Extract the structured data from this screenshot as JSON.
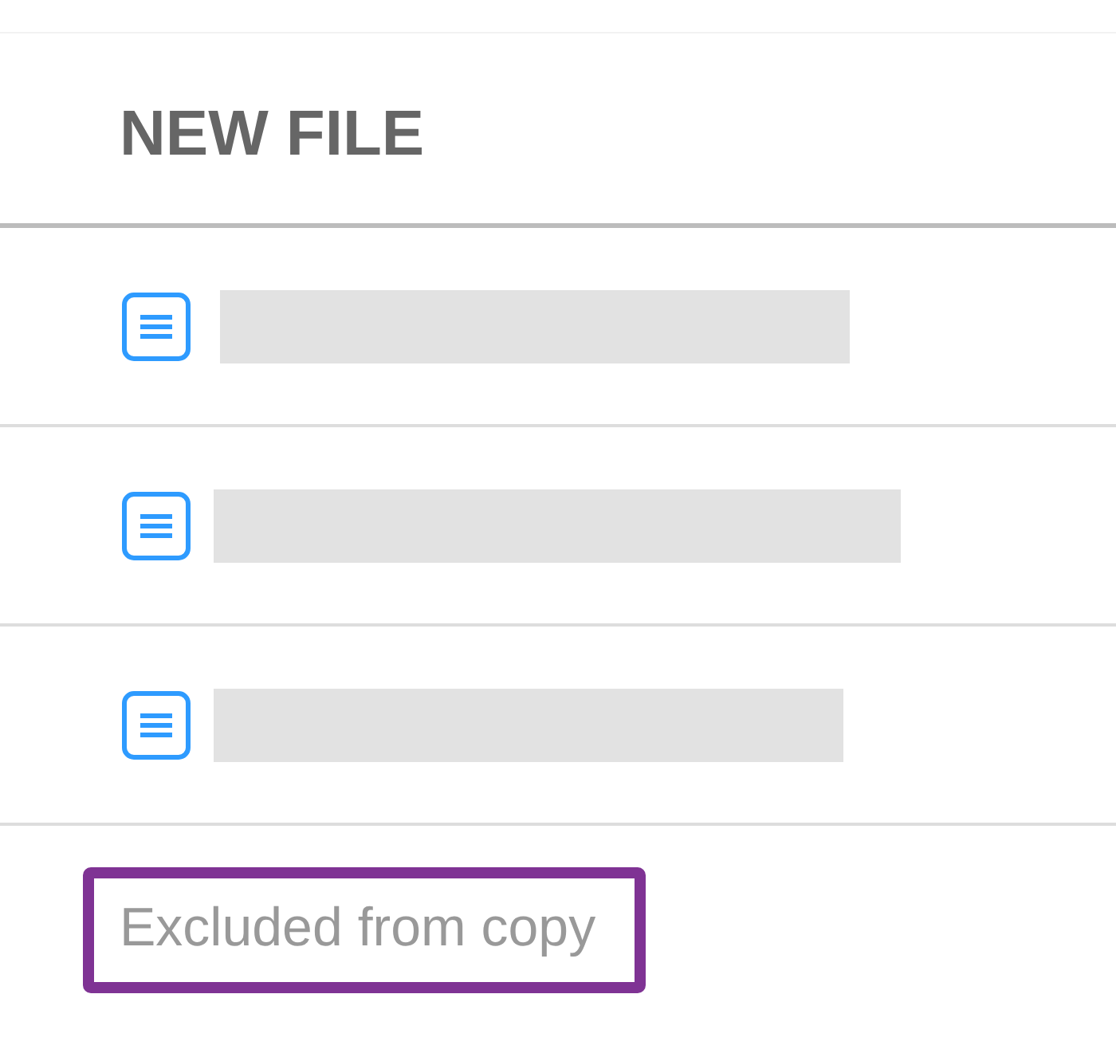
{
  "section": {
    "title": "NEW FILE"
  },
  "files": [
    {
      "kind": "redacted"
    },
    {
      "kind": "redacted"
    },
    {
      "kind": "redacted"
    }
  ],
  "note": {
    "text": "Excluded from copy",
    "highlighted": true
  }
}
